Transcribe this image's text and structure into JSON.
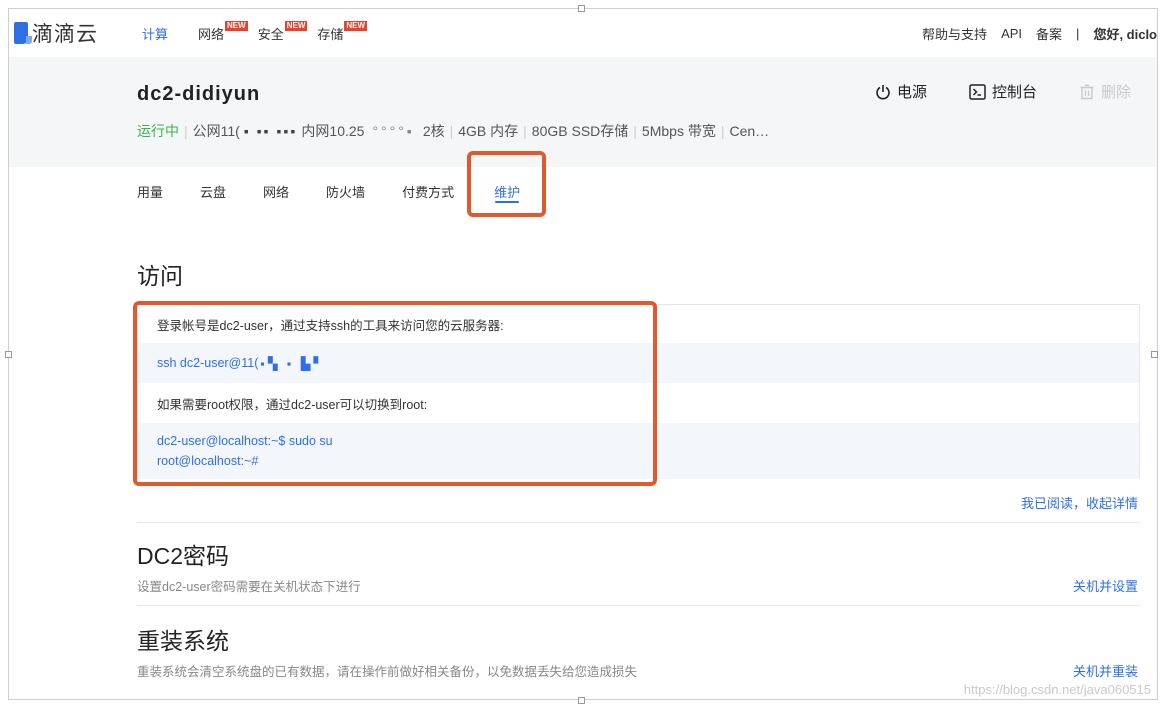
{
  "nav": {
    "logo_text": "滴滴云",
    "items": [
      {
        "label": "计算",
        "badge": ""
      },
      {
        "label": "网络",
        "badge": "NEW"
      },
      {
        "label": "安全",
        "badge": "NEW"
      },
      {
        "label": "存储",
        "badge": "NEW"
      }
    ],
    "right": {
      "help": "帮助与支持",
      "api": "API",
      "filing": "备案",
      "separator": "|",
      "greeting": "您好, diclo"
    }
  },
  "server": {
    "name": "dc2-didiyun",
    "status": "运行中",
    "public_ip": "公网11(",
    "private_ip": "内网10.25",
    "cpu": "2核",
    "memory": "4GB 内存",
    "disk": "80GB SSD存储",
    "bandwidth": "5Mbps 带宽",
    "os": "Cen…",
    "actions": {
      "power": "电源",
      "console": "控制台",
      "delete": "删除"
    }
  },
  "tabs": [
    "用量",
    "云盘",
    "网络",
    "防火墙",
    "付费方式",
    "维护"
  ],
  "access": {
    "title": "访问",
    "login_hint": "登录帐号是dc2-user，通过支持ssh的工具来访问您的云服务器:",
    "ssh_command": "ssh dc2-user@11(",
    "root_hint": "如果需要root权限，通过dc2-user可以切换到root:",
    "sudo_line": "dc2-user@localhost:~$ sudo su",
    "root_line": "root@localhost:~#",
    "collapse_link": "我已阅读，收起详情"
  },
  "password": {
    "title": "DC2密码",
    "desc": "设置dc2-user密码需要在关机状态下进行",
    "link": "关机并设置"
  },
  "reinstall": {
    "title": "重装系统",
    "desc": "重装系统会清空系统盘的已有数据，请在操作前做好相关备份，以免数据丢失给您造成损失",
    "link": "关机并重装"
  },
  "watermark": "https://blog.csdn.net/java060515",
  "colors": {
    "accent": "#2f6fe6",
    "running": "#3cb44b",
    "highlight": "#e05a2e",
    "badge": "#e8412d"
  }
}
